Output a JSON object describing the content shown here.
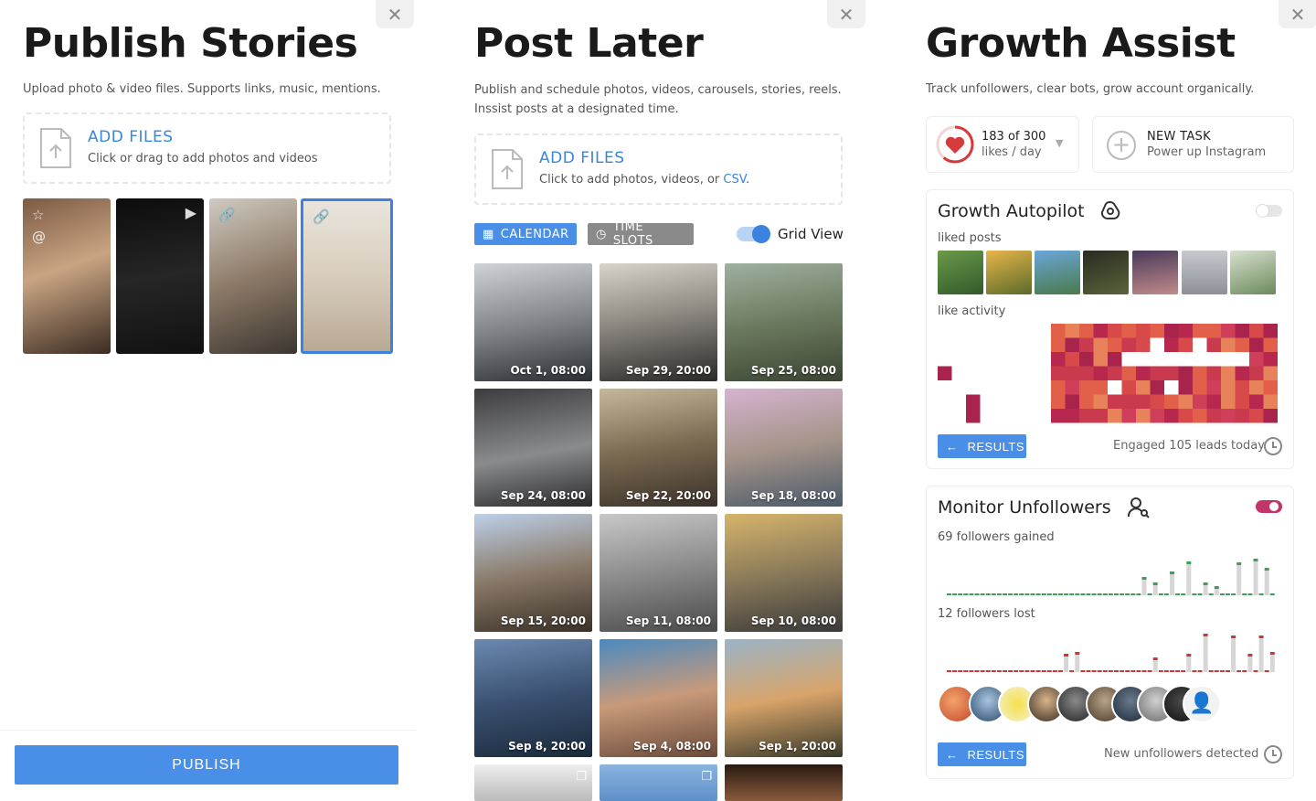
{
  "publish_stories": {
    "title": "Publish Stories",
    "subtitle": "Upload photo & video files. Supports links, music, mentions.",
    "add_files_title": "ADD FILES",
    "add_files_sub": "Click or drag to add photos and videos",
    "publish_label": "PUBLISH"
  },
  "post_later": {
    "title": "Post Later",
    "subtitle_line1": "Publish and schedule photos, videos, carousels, stories, reels.",
    "subtitle_line2": "Inssist posts at a designated time.",
    "add_files_title": "ADD FILES",
    "add_files_sub": "Click to add photos, videos, or ",
    "add_files_csv": "CSV",
    "add_files_end": ".",
    "calendar_label": "CALENDAR",
    "time_slots_label": "TIME SLOTS",
    "grid_view_label": "Grid View",
    "grid_view_on": true,
    "posts": [
      {
        "date": "Oct 1, 08:00"
      },
      {
        "date": "Sep 29, 20:00"
      },
      {
        "date": "Sep 25, 08:00"
      },
      {
        "date": "Sep 24, 08:00"
      },
      {
        "date": "Sep 22, 20:00"
      },
      {
        "date": "Sep 18, 08:00"
      },
      {
        "date": "Sep 15, 20:00"
      },
      {
        "date": "Sep 11, 08:00"
      },
      {
        "date": "Sep 10, 08:00"
      },
      {
        "date": "Sep 8, 20:00"
      },
      {
        "date": "Sep 4, 08:00"
      },
      {
        "date": "Sep 1, 20:00"
      }
    ]
  },
  "growth_assist": {
    "title": "Growth Assist",
    "subtitle": "Track unfollowers, clear bots, grow account organically.",
    "likes_count": "183 of 300",
    "likes_unit": "likes / day",
    "new_task_title": "NEW TASK",
    "new_task_sub": "Power up Instagram",
    "autopilot": {
      "title": "Growth Autopilot",
      "enabled": false,
      "liked_posts_label": "liked posts",
      "like_activity_label": "like activity",
      "results_label": "RESULTS",
      "status": "Engaged 105 leads today"
    },
    "unfollowers": {
      "title": "Monitor Unfollowers",
      "enabled": true,
      "gained_label": "69 followers gained",
      "lost_label": "12 followers lost",
      "results_label": "RESULTS",
      "status": "New unfollowers detected"
    }
  },
  "colors": {
    "accent_blue": "#4a8fe7",
    "toggle_on_pink": "#c2356b",
    "heatmap_high": "#b8284e",
    "bar_green": "#3f9e5a",
    "bar_red": "#c83838"
  }
}
